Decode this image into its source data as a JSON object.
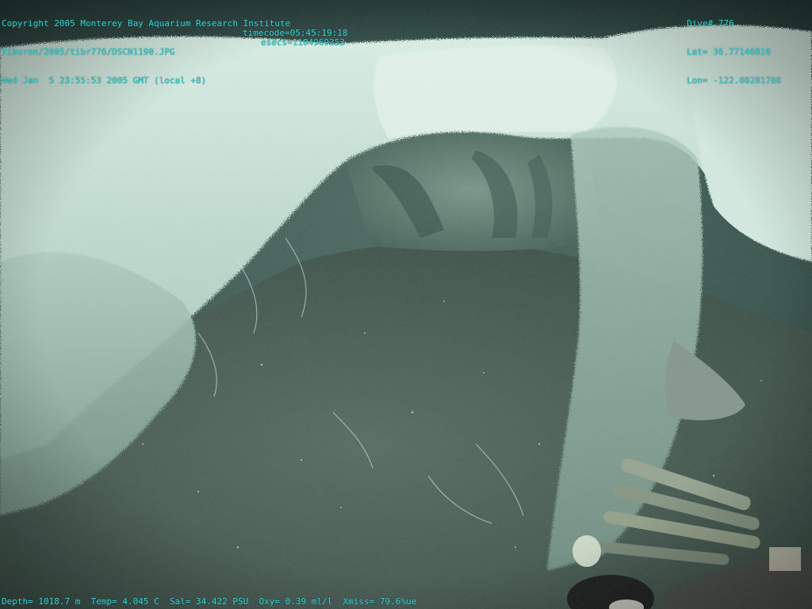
{
  "overlay": {
    "copyright": "Copyright 2005 Monterey Bay Aquarium Research Institute",
    "file_path": "Tiburon/2005/tibr776/DSCN1190.JPG",
    "timecode": "timecode=05:45:19:18",
    "datetime": "Wed Jan  5 23:55:53 2005 GMT (local +8)",
    "esecs": "esecs=1104969353",
    "dive": "Dive# 776",
    "lat": "Lat= 36.77146810",
    "lon": "Lon= -122.08281708",
    "depth": "Depth= 1018.7 m",
    "temp": "Temp= 4.045 C",
    "sal": "Sal= 34.422 PSU",
    "oxy": "Oxy= 0.39 ml/l",
    "xmiss": "Xmiss= 79.6%ue"
  },
  "colors": {
    "overlay_text": "#2fd8d8",
    "water": "#24413a",
    "mat": "#b9d6c8",
    "sediment": "#3b4f46"
  }
}
